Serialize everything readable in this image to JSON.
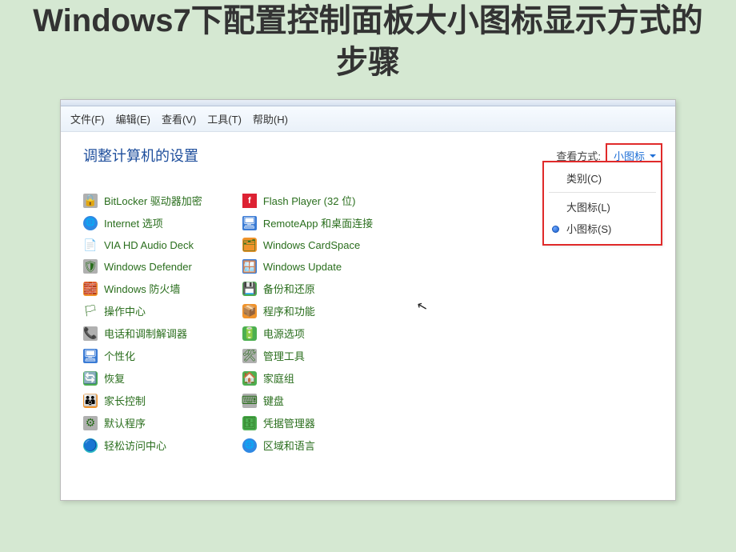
{
  "title": "Windows7下配置控制面板大小图标显示方式的步骤",
  "menubar": [
    "文件(F)",
    "编辑(E)",
    "查看(V)",
    "工具(T)",
    "帮助(H)"
  ],
  "heading": "调整计算机的设置",
  "view_label": "查看方式:",
  "view_value": "小图标",
  "dropdown": {
    "category": "类别(C)",
    "large": "大图标(L)",
    "small": "小图标(S)"
  },
  "col1": [
    "BitLocker 驱动器加密",
    "Internet 选项",
    "VIA HD Audio Deck",
    "Windows Defender",
    "Windows 防火墙",
    "操作中心",
    "电话和调制解调器",
    "个性化",
    "恢复",
    "家长控制",
    "默认程序",
    "轻松访问中心"
  ],
  "col2": [
    "Flash Player (32 位)",
    "RemoteApp 和桌面连接",
    "Windows CardSpace",
    "Windows Update",
    "备份和还原",
    "程序和功能",
    "电源选项",
    "管理工具",
    "家庭组",
    "键盘",
    "凭据管理器",
    "区域和语言"
  ],
  "icons1": [
    "🔒",
    "🌐",
    "📄",
    "🛡",
    "🧱",
    "🏳",
    "📞",
    "🖥",
    "🔄",
    "👪",
    "⚙",
    "🔵"
  ],
  "icons2": [
    "f",
    "🖥",
    "🗂",
    "🪟",
    "💾",
    "📦",
    "🔋",
    "🛠",
    "🏠",
    "⌨",
    "🗄",
    "🌐"
  ],
  "icon_classes1": [
    "sq-grey",
    "circle-blue",
    "",
    "sq-grey",
    "sq-orange",
    "",
    "sq-grey",
    "sq-blue",
    "sq-green",
    "sq-orange",
    "sq-grey",
    "sq-teal"
  ],
  "icon_classes2": [
    "sq-red",
    "sq-blue",
    "sq-orange",
    "sq-blue",
    "sq-green",
    "sq-orange",
    "sq-green",
    "sq-grey",
    "sq-green",
    "sq-grey",
    "sq-green",
    "circle-blue"
  ]
}
